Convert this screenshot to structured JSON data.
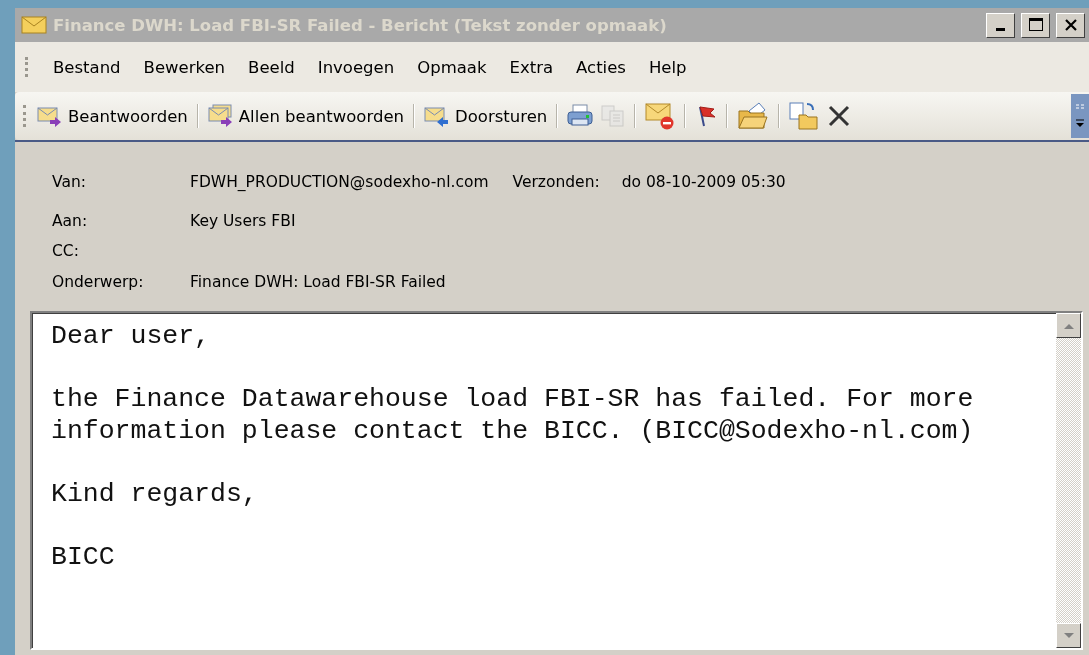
{
  "window": {
    "title": "Finance DWH: Load FBI-SR Failed - Bericht (Tekst zonder opmaak)",
    "active": false
  },
  "menu": [
    {
      "label": "Bestand"
    },
    {
      "label": "Bewerken"
    },
    {
      "label": "Beeld"
    },
    {
      "label": "Invoegen"
    },
    {
      "label": "Opmaak"
    },
    {
      "label": "Extra"
    },
    {
      "label": "Acties"
    },
    {
      "label": "Help"
    }
  ],
  "toolbar": [
    {
      "kind": "labeled",
      "label": "Beantwoorden",
      "disabled": false
    },
    {
      "kind": "separator"
    },
    {
      "kind": "labeled",
      "label": "Allen beantwoorden",
      "disabled": false
    },
    {
      "kind": "separator"
    },
    {
      "kind": "labeled",
      "label": "Doorsturen",
      "disabled": false
    },
    {
      "kind": "separator"
    },
    {
      "kind": "icon",
      "disabled": false
    },
    {
      "kind": "icon",
      "disabled": true
    },
    {
      "kind": "separator"
    },
    {
      "kind": "icon",
      "disabled": false
    },
    {
      "kind": "separator"
    },
    {
      "kind": "icon",
      "disabled": false
    },
    {
      "kind": "separator"
    },
    {
      "kind": "icon",
      "disabled": false
    },
    {
      "kind": "separator"
    },
    {
      "kind": "icon",
      "disabled": false
    },
    {
      "kind": "icon",
      "disabled": false
    }
  ],
  "header": {
    "from_label": "Van:",
    "from": "FDWH_PRODUCTION@sodexho-nl.com",
    "sent_label": "Verzonden:",
    "sent": "do 08-10-2009 05:30",
    "to_label": "Aan:",
    "to": "Key Users FBI",
    "cc_label": "CC:",
    "subject_label": "Onderwerp:",
    "subject": "Finance DWH: Load FBI-SR Failed"
  },
  "body": {
    "paragraphs": [
      [
        "Dear user,"
      ],
      [
        "the Finance Datawarehouse load FBI-SR has failed. For more",
        "information please contact the BICC. (BICC@Sodexho-nl.com)"
      ],
      [
        "Kind regards,"
      ],
      [
        "BICC"
      ]
    ]
  }
}
